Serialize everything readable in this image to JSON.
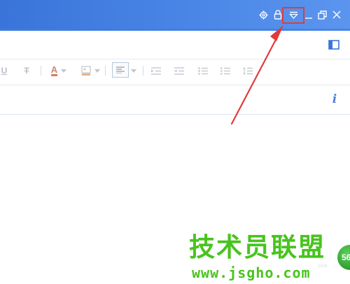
{
  "titlebar": {
    "controls": [
      {
        "name": "settings-icon"
      },
      {
        "name": "lock-icon"
      },
      {
        "name": "dropdown-menu-icon"
      },
      {
        "name": "minimize-icon"
      },
      {
        "name": "restore-icon"
      },
      {
        "name": "close-icon"
      }
    ],
    "highlight_color": "#e23b3b"
  },
  "toolbar": {
    "split_view_icon": "split-view-icon",
    "items": [
      {
        "name": "underline-button",
        "glyph": "U"
      },
      {
        "name": "strikethrough-button",
        "glyph": "T"
      },
      {
        "name": "font-color-button",
        "glyph": "A"
      },
      {
        "name": "background-color-button"
      },
      {
        "name": "align-button"
      },
      {
        "name": "indent-increase-button"
      },
      {
        "name": "indent-decrease-button"
      },
      {
        "name": "bullet-list-button"
      },
      {
        "name": "numbered-list-button"
      },
      {
        "name": "line-spacing-button"
      }
    ]
  },
  "subject": {
    "info_glyph": "i"
  },
  "watermark": {
    "site_name": "技术员联盟",
    "url": "www.jsgho.com",
    "badge": "56"
  },
  "colors": {
    "titlebar": "#4a86e6",
    "accent": "#4a84e2",
    "annotation": "#e23b3b",
    "watermark": "#48c41d"
  }
}
